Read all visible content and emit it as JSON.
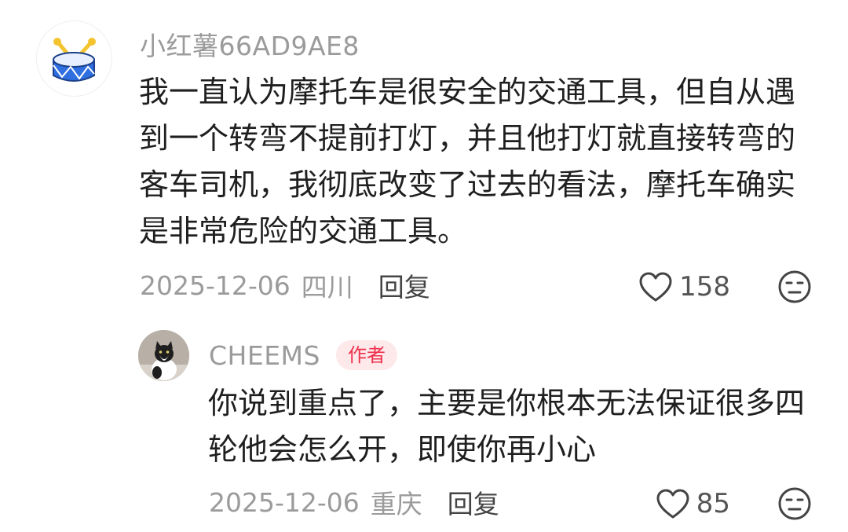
{
  "comments": {
    "top": {
      "author": "小红薯66AD9AE8",
      "text": "我一直认为摩托车是很安全的交通工具，但自从遇到一个转弯不提前打灯，并且他打灯就直接转弯的客车司机，我彻底改变了过去的看法，摩托车确实是非常危险的交通工具。",
      "date": "2025-12-06",
      "location": "四川",
      "reply_label": "回复",
      "like_count": "158",
      "avatar_icon": "drum-icon"
    },
    "reply": {
      "author": "CHEEMS",
      "author_tag": "作者",
      "text": "你说到重点了，主要是你根本无法保证很多四轮他会怎么开，即使你再小心",
      "date": "2025-12-06",
      "location": "重庆",
      "reply_label": "回复",
      "like_count": "85",
      "avatar_icon": "cat-avatar"
    }
  },
  "colors": {
    "accent_tag_bg": "#fde8ea",
    "accent_tag_text": "#ee2f4b",
    "meta_text": "#9b9b9b",
    "body_text": "#1f1f1f"
  }
}
